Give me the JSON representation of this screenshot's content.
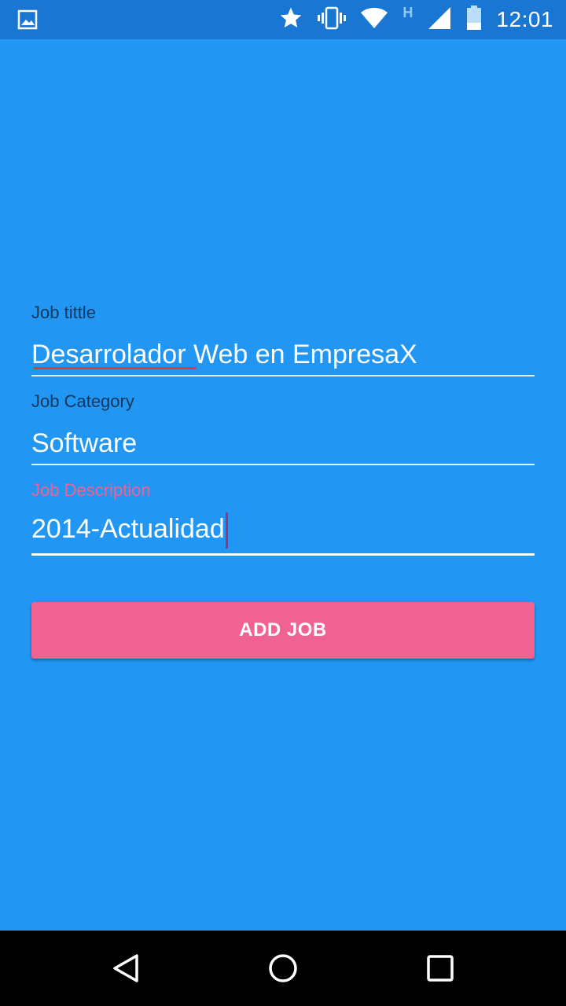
{
  "status_bar": {
    "time": "12:01",
    "network_type": "H",
    "icons": [
      "image-icon",
      "star-icon",
      "vibrate-icon",
      "wifi-icon",
      "signal-icon",
      "battery-icon"
    ]
  },
  "form": {
    "job_title": {
      "label": "Job tittle",
      "value": "Desarrolador Web en EmpresaX"
    },
    "job_category": {
      "label": "Job Category",
      "value": "Software"
    },
    "job_description": {
      "label": "Job Description",
      "value": "2014-Actualidad"
    },
    "submit_label": "ADD JOB"
  },
  "colors": {
    "background": "#2196F3",
    "status_bar": "#1976D2",
    "accent": "#F06292",
    "label": "#12375e"
  },
  "nav_bar": {
    "icons": [
      "back-icon",
      "home-icon",
      "recents-icon"
    ]
  }
}
